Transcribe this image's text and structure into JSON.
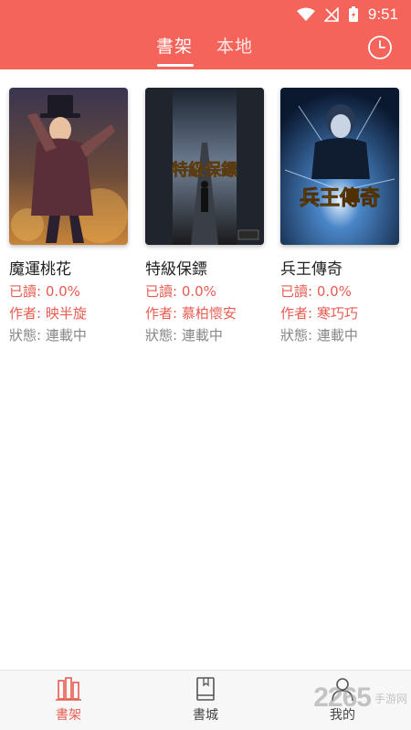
{
  "status_bar": {
    "time": "9:51"
  },
  "tabs": [
    {
      "label": "書架",
      "active": true
    },
    {
      "label": "本地",
      "active": false
    }
  ],
  "books": [
    {
      "title": "魔運桃花",
      "read": "已讀: 0.0%",
      "author": "作者: 映半旋",
      "status": "狀態: 連載中",
      "cover_text": ""
    },
    {
      "title": "特級保鏢",
      "read": "已讀: 0.0%",
      "author": "作者: 慕柏懷安",
      "status": "狀態: 連載中",
      "cover_text": "特級保鏢"
    },
    {
      "title": "兵王傳奇",
      "read": "已讀: 0.0%",
      "author": "作者: 寒巧巧",
      "status": "狀態: 連載中",
      "cover_text": "兵王傳奇"
    }
  ],
  "bottom_nav": [
    {
      "label": "書架",
      "icon": "bookshelf-icon",
      "active": true
    },
    {
      "label": "書城",
      "icon": "book-icon",
      "active": false
    },
    {
      "label": "我的",
      "icon": "user-icon",
      "active": false
    }
  ],
  "watermark": {
    "big": "2265",
    "small": "手游网"
  },
  "colors": {
    "accent": "#f4645a",
    "active_text": "#e65c50",
    "muted_text": "#888888"
  }
}
